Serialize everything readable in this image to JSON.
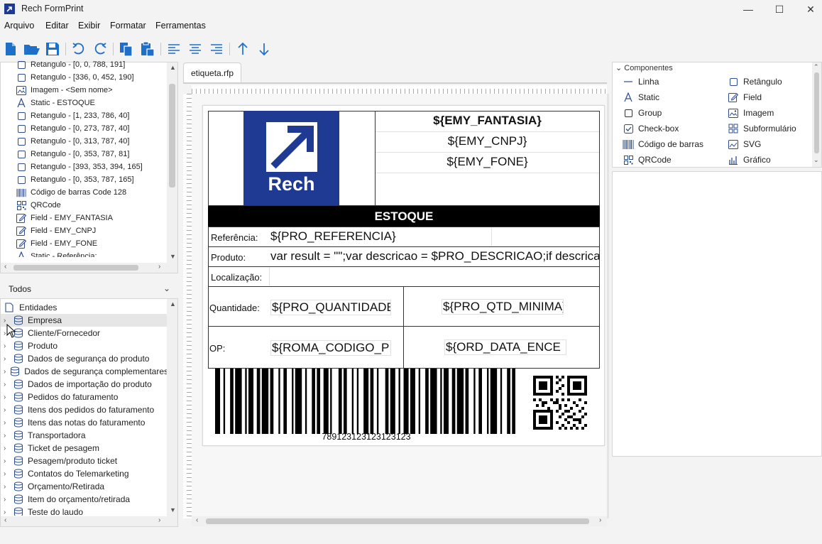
{
  "window": {
    "title": "Rech FormPrint",
    "controls": [
      "—",
      "☐",
      "✕"
    ]
  },
  "menu": [
    "Arquivo",
    "Editar",
    "Exibir",
    "Formatar",
    "Ferramentas"
  ],
  "outline": [
    {
      "icon": "rect",
      "label": "Retangulo - [0, 0, 788, 191]"
    },
    {
      "icon": "rect",
      "label": "Retangulo - [336, 0, 452, 190]"
    },
    {
      "icon": "image",
      "label": "Imagem - <Sem nome>"
    },
    {
      "icon": "static",
      "label": "Static - ESTOQUE"
    },
    {
      "icon": "rect",
      "label": "Retangulo - [1, 233, 786, 40]"
    },
    {
      "icon": "rect",
      "label": "Retangulo - [0, 273, 787, 40]"
    },
    {
      "icon": "rect",
      "label": "Retangulo - [0, 313, 787, 40]"
    },
    {
      "icon": "rect",
      "label": "Retangulo - [0, 353, 787, 81]"
    },
    {
      "icon": "rect",
      "label": "Retangulo - [393, 353, 394, 165]"
    },
    {
      "icon": "rect",
      "label": "Retangulo - [0, 353, 787, 165]"
    },
    {
      "icon": "barcode",
      "label": "Código de barras Code 128"
    },
    {
      "icon": "qr",
      "label": "QRCode"
    },
    {
      "icon": "field",
      "label": "Field - EMY_FANTASIA"
    },
    {
      "icon": "field",
      "label": "Field - EMY_CNPJ"
    },
    {
      "icon": "field",
      "label": "Field - EMY_FONE"
    },
    {
      "icon": "static",
      "label": "Static - Referência:"
    }
  ],
  "entities": {
    "filter_label": "Todos",
    "root_label": "Entidades",
    "items": [
      "Empresa",
      "Cliente/Fornecedor",
      "Produto",
      "Dados de segurança do produto",
      "Dados de segurança complementares",
      "Dados de importação do produto",
      "Pedidos do faturamento",
      "Itens dos pedidos do faturamento",
      "Itens das notas do faturamento",
      "Transportadora",
      "Ticket de pesagem",
      "Pesagem/produto ticket",
      "Contatos do Telemarketing",
      "Orçamento/Retirada",
      "Item do orçamento/retirada",
      "Teste do laudo"
    ]
  },
  "document": {
    "tab_label": "etiqueta.rfp",
    "logo_text": "Rech",
    "header_fields": [
      "${EMY_FANTASIA}",
      "${EMY_CNPJ}",
      "${EMY_FONE}"
    ],
    "section_title": "ESTOQUE",
    "rows": {
      "referencia_label": "Referência:",
      "referencia_value": "${PRO_REFERENCIA}",
      "produto_label": "Produto:",
      "produto_value": "var result = \"\";var descricao = $PRO_DESCRICAO;if descricao",
      "localizacao_label": "Localização:",
      "quantidade_label": "Quantidade:",
      "quantidade_value": "${PRO_QUANTIDADE}",
      "qtd_minima_value": "${PRO_QTD_MINIMA}",
      "op_label": "OP:",
      "op_value": "${ROMA_CODIGO_P",
      "data_value": "${ORD_DATA_ENCE"
    },
    "barcode_text": "789123123123123123"
  },
  "components": {
    "header": "Componentes",
    "items_left": [
      {
        "icon": "line",
        "label": "Linha"
      },
      {
        "icon": "static",
        "label": "Static"
      },
      {
        "icon": "group",
        "label": "Group"
      },
      {
        "icon": "checkbox",
        "label": "Check-box"
      },
      {
        "icon": "barcode",
        "label": "Código de barras"
      },
      {
        "icon": "qr",
        "label": "QRCode"
      }
    ],
    "items_right": [
      {
        "icon": "rect",
        "label": "Retângulo"
      },
      {
        "icon": "field",
        "label": "Field"
      },
      {
        "icon": "image",
        "label": "Imagem"
      },
      {
        "icon": "subform",
        "label": "Subformulário"
      },
      {
        "icon": "svg",
        "label": "SVG"
      },
      {
        "icon": "chart",
        "label": "Gráfico"
      }
    ]
  },
  "colors": {
    "accent": "#1f3a93",
    "logo_bg": "#1f3a93",
    "section_bar": "#000000"
  }
}
